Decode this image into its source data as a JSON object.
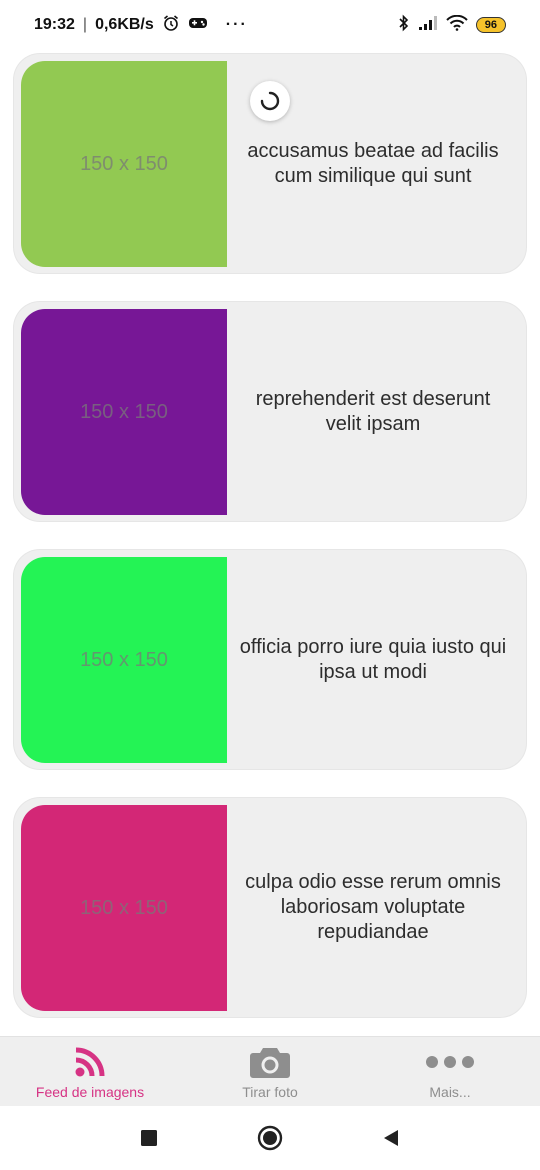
{
  "status_bar": {
    "time": "19:32",
    "network_speed": "0,6KB/s",
    "more_indicator": "···",
    "battery_level": "96",
    "icons": [
      "alarm-icon",
      "game-controller-icon",
      "bluetooth-icon",
      "signal-icon",
      "wifi-icon",
      "battery-icon"
    ]
  },
  "feed": {
    "items": [
      {
        "thumb_label": "150 x 150",
        "thumb_color": "#92c952",
        "title": "accusamus beatae ad facilis cum similique qui sunt"
      },
      {
        "thumb_label": "150 x 150",
        "thumb_color": "#771796",
        "title": "reprehenderit est deserunt velit ipsam"
      },
      {
        "thumb_label": "150 x 150",
        "thumb_color": "#24f355",
        "title": "officia porro iure quia iusto qui ipsa ut modi"
      },
      {
        "thumb_label": "150 x 150",
        "thumb_color": "#d32776",
        "title": "culpa odio esse rerum omnis laboriosam voluptate repudiandae"
      }
    ]
  },
  "tab_bar": {
    "accent_color": "#d63384",
    "inactive_color": "#8e8e8e",
    "tabs": [
      {
        "label": "Feed de imagens",
        "icon": "rss-feed-icon",
        "active": true
      },
      {
        "label": "Tirar foto",
        "icon": "camera-icon",
        "active": false
      },
      {
        "label": "Mais...",
        "icon": "more-dots-icon",
        "active": false
      }
    ]
  },
  "system_nav": {
    "buttons": [
      "recents-square-icon",
      "home-circle-icon",
      "back-triangle-icon"
    ]
  }
}
